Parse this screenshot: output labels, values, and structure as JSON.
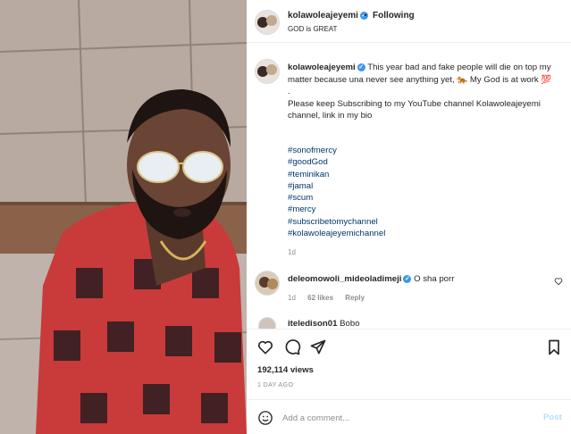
{
  "post": {
    "username": "kolawoleajeyemi",
    "verified_icon": "verified-badge-icon",
    "dot": "•",
    "follow_status": "Following",
    "subtitle": "GOD is GREAT"
  },
  "caption": {
    "username": "kolawoleajeyemi",
    "line1": " This year bad and fake people will die on top my matter because una never see anything yet, 🐅 My God is at work 💯",
    "line2": ".",
    "line3": "Please keep Subscribing to my YouTube channel Kolawoleajeyemi channel, link in my bio",
    "hashtags": [
      "#sonofmercy",
      "#goodGod",
      "#teminikan",
      "#jamal",
      "#scum",
      "#mercy",
      "#subscribetomychannel",
      "#kolawoleajeyemichannel"
    ],
    "time": "1d"
  },
  "comments": [
    {
      "username": "deleomowoli_mideoladimeji",
      "text": " O sha porr",
      "time": "1d",
      "likes": "62 likes",
      "reply_label": "Reply"
    },
    {
      "username": "iteledison01",
      "text": " Bobo"
    }
  ],
  "actions": {
    "icons": [
      "heart-icon",
      "comment-icon",
      "share-icon",
      "bookmark-icon"
    ],
    "views": "192,114 views",
    "posted": "1 DAY AGO"
  },
  "add_comment": {
    "placeholder": "Add a comment...",
    "post_label": "Post"
  },
  "colors": {
    "link": "#00376b",
    "verified": "#3897f0",
    "muted": "#8e8e8e",
    "post_disabled": "#b2dffc"
  }
}
